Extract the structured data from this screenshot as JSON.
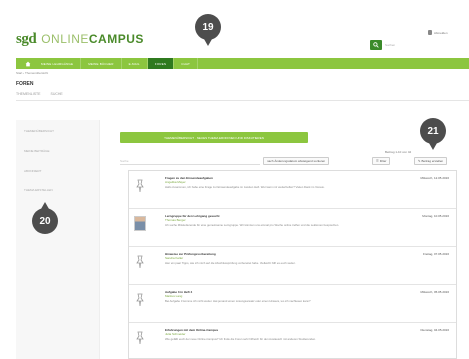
{
  "header": {
    "logo_sgd": "sgd",
    "logo_online": "ONLINE",
    "logo_campus": "CAMPUS",
    "search_placeholder": "Suchen",
    "user_label": "Abmelden"
  },
  "nav": {
    "items": [
      {
        "label": "MEINE LEHRGÄNGE",
        "active": false
      },
      {
        "label": "MEINE BÜCHER",
        "active": false
      },
      {
        "label": "E-MAIL",
        "active": false
      },
      {
        "label": "FOREN",
        "active": true
      },
      {
        "label": "CHAT",
        "active": false
      }
    ]
  },
  "breadcrumb": "Start › Themenübersicht",
  "page_title": "FOREN",
  "sub_tabs": [
    "THEMENLISTE",
    "SUCHE"
  ],
  "sidebar": {
    "links": [
      "THEMENÜBERSICHT",
      "MEINE BEITRÄGE",
      "ABONNIERT",
      "THEMA ERSTELLEN"
    ]
  },
  "main": {
    "banner": "THEMENÜBERSICHT · NEUES THEMA EROFFNEN UND DISKUTIEREN",
    "result_info": "Beitrag 1-10 von 42",
    "search_placeholder": "Suche",
    "sort_label": "nach Änderungsdatum absteigend sortieren",
    "filter_label": "Filter",
    "new_post_label": "Beitrag erstellen"
  },
  "posts": [
    {
      "title": "Fragen zu den Einsendeaufgaben",
      "author": "Angelika Mayer",
      "date": "Mittwoch, 12.05.2016",
      "snippet": "Hallo zusammen, ich habe eine Frage zur Einsendeaufgabe im zweiten Heft. Wer kann mir weiterhelfen? Vielen Dank im Voraus.",
      "photo": false
    },
    {
      "title": "Lerngruppe für den Lehrgang gesucht",
      "author": "Thomas Berger",
      "date": "Montag, 10.05.2016",
      "snippet": "Ich suche Mitstudierende für eine gemeinsame Lerngruppe. Wir könnten uns einmal pro Woche online treffen und die Lektionen besprechen.",
      "photo": true
    },
    {
      "title": "Hinweise zur Prüfungsvorbereitung",
      "author": "Sandra Keller",
      "date": "Freitag, 07.05.2016",
      "snippet": "Hier ein paar Tipps, wie ich mich auf die Abschlussprüfung vorbereitet habe. Vielleicht hilft es euch weiter.",
      "photo": false
    },
    {
      "title": "Aufgabe 3 in Heft 4",
      "author": "Markus Lang",
      "date": "Mittwoch, 05.05.2016",
      "snippet": "Bei Aufgabe 3 komme ich nicht weiter. Hat jemand einen Lösungsansatz oder einen Hinweis, wo ich nachlesen kann?",
      "photo": false
    },
    {
      "title": "Erfahrungen mit dem Online-Campus",
      "author": "Julia Schneider",
      "date": "Dienstag, 04.05.2016",
      "snippet": "Wie gefällt euch der neue Online-Campus? Ich finde die Foren sehr hilfreich für den Austausch mit anderen Studierenden.",
      "photo": false
    }
  ],
  "callouts": [
    "19",
    "20",
    "21"
  ]
}
